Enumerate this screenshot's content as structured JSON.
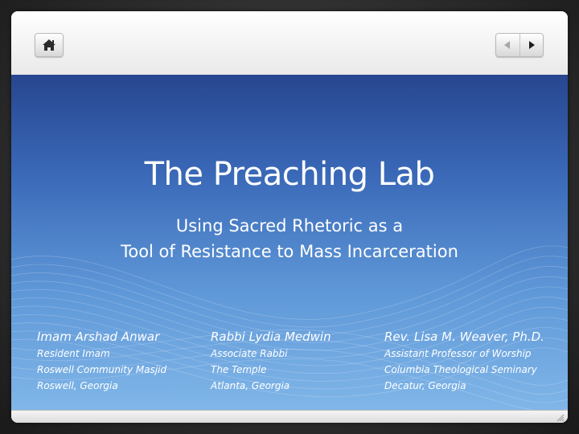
{
  "toolbar": {
    "home_icon": "home-icon",
    "prev_icon": "triangle-left-icon",
    "next_icon": "triangle-right-icon"
  },
  "slide": {
    "title": "The Preaching Lab",
    "subtitle_line1": "Using Sacred Rhetoric as a",
    "subtitle_line2": "Tool of Resistance to Mass Incarceration",
    "presenters": [
      {
        "name": "Imam Arshad Anwar",
        "role": "Resident Imam",
        "organization": "Roswell Community Masjid",
        "location": "Roswell, Georgia"
      },
      {
        "name": "Rabbi Lydia Medwin",
        "role": "Associate Rabbi",
        "organization": "The Temple",
        "location": "Atlanta, Georgia"
      },
      {
        "name": "Rev. Lisa M. Weaver, Ph.D.",
        "role": "Assistant Professor of Worship",
        "organization": "Columbia Theological Seminary",
        "location": "Decatur, Georgia"
      }
    ]
  },
  "colors": {
    "slide_top": "#27468f",
    "slide_bottom": "#80b6e8",
    "text": "#ffffff"
  }
}
